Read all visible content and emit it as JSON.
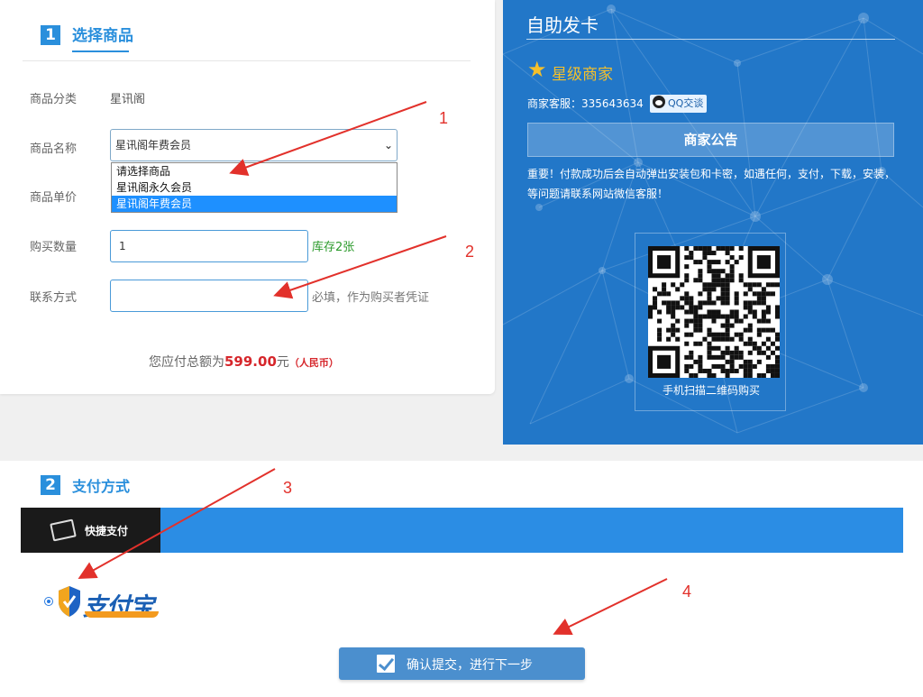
{
  "step1": {
    "number": "1",
    "title": "选择商品"
  },
  "form": {
    "category_label": "商品分类",
    "category_value": "星讯阁",
    "name_label": "商品名称",
    "name_selected": "星讯阁年费会员",
    "dropdown_options": [
      "请选择商品",
      "星讯阁永久会员",
      "星讯阁年费会员"
    ],
    "price_label": "商品单价",
    "qty_label": "购买数量",
    "qty_value": "1",
    "stock": "库存2张",
    "contact_label": "联系方式",
    "contact_value": "",
    "contact_hint": "必填，作为购买者凭证",
    "total_prefix": "您应付总额为",
    "total_amount": "599.00",
    "total_unit": "元",
    "total_currency": "（人民币）"
  },
  "panel": {
    "title": "自助发卡",
    "merchant": "星级商家",
    "cs_label": "商家客服：",
    "cs_number": "335643634",
    "qq_button": "QQ交谈",
    "notice_button": "商家公告",
    "notice_text": "重要！付款成功后会自动弹出安装包和卡密，如遇任何，支付，下载，安装，等问题请联系网站微信客服！",
    "qr_caption": "手机扫描二维码购买"
  },
  "step2": {
    "number": "2",
    "title": "支付方式"
  },
  "payment": {
    "tab_label": "快捷支付",
    "method": "支付宝",
    "submit_label": "确认提交，进行下一步"
  },
  "annotations": [
    "1",
    "2",
    "3",
    "4"
  ],
  "colors": {
    "accent": "#2a8fdc",
    "panel": "#2277c8",
    "price": "#d6262b",
    "stock": "#2b9a2b",
    "arrow": "#e2312b"
  }
}
